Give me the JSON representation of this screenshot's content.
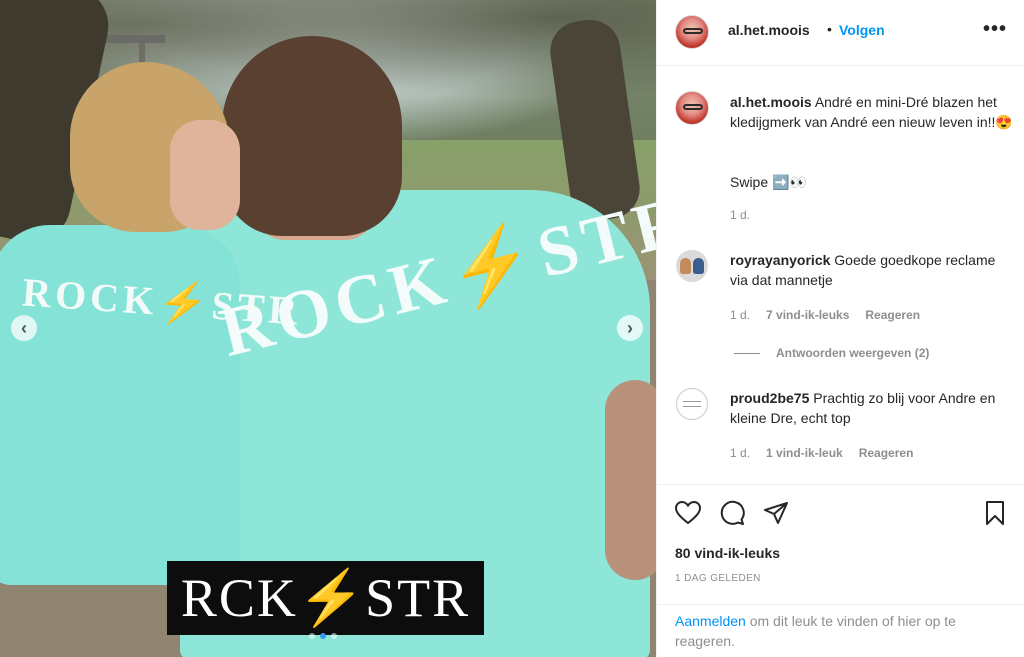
{
  "post": {
    "username": "al.het.moois",
    "separator": "•",
    "follow_label": "Volgen",
    "more_icon": "more-options-icon",
    "more_label": "•••"
  },
  "photo": {
    "shirt_text_small": "ROCK⚡STR",
    "shirt_text_big": "ROCK⚡STR",
    "brand_left": "RCK",
    "brand_bolt": "⚡",
    "brand_right": "STR",
    "nav_prev": "‹",
    "nav_next": "›",
    "carousel_dots": 3,
    "active_dot": 1
  },
  "caption": {
    "username": "al.het.moois",
    "text": "André en mini-Dré blazen het kledijgmerk van André een nieuw leven in!!😍",
    "text2": "Swipe ➡️👀",
    "time": "1 d."
  },
  "comments": [
    {
      "username": "royrayanyorick",
      "text": "Goede goedkope reclame via dat mannetje",
      "time": "1 d.",
      "likes": "7 vind-ik-leuks",
      "reply": "Reageren",
      "view_replies": "Antwoorden weergeven (2)"
    },
    {
      "username": "proud2be75",
      "text": "Prachtig zo blij voor Andre en kleine Dre, echt top",
      "time": "1 d.",
      "likes": "1 vind-ik-leuk",
      "reply": "Reageren"
    }
  ],
  "actions": {
    "icons": [
      "heart-icon",
      "comment-icon",
      "share-icon",
      "bookmark-icon"
    ],
    "likes_count": "80 vind-ik-leuks",
    "posted": "1 DAG GELEDEN"
  },
  "login": {
    "link": "Aanmelden",
    "text": "om dit leuk te vinden of hier op te reageren."
  },
  "colors": {
    "link_blue": "#0095f6",
    "shirt_mint": "#8ee6d9",
    "bolt_yellow": "#f2c21c"
  }
}
